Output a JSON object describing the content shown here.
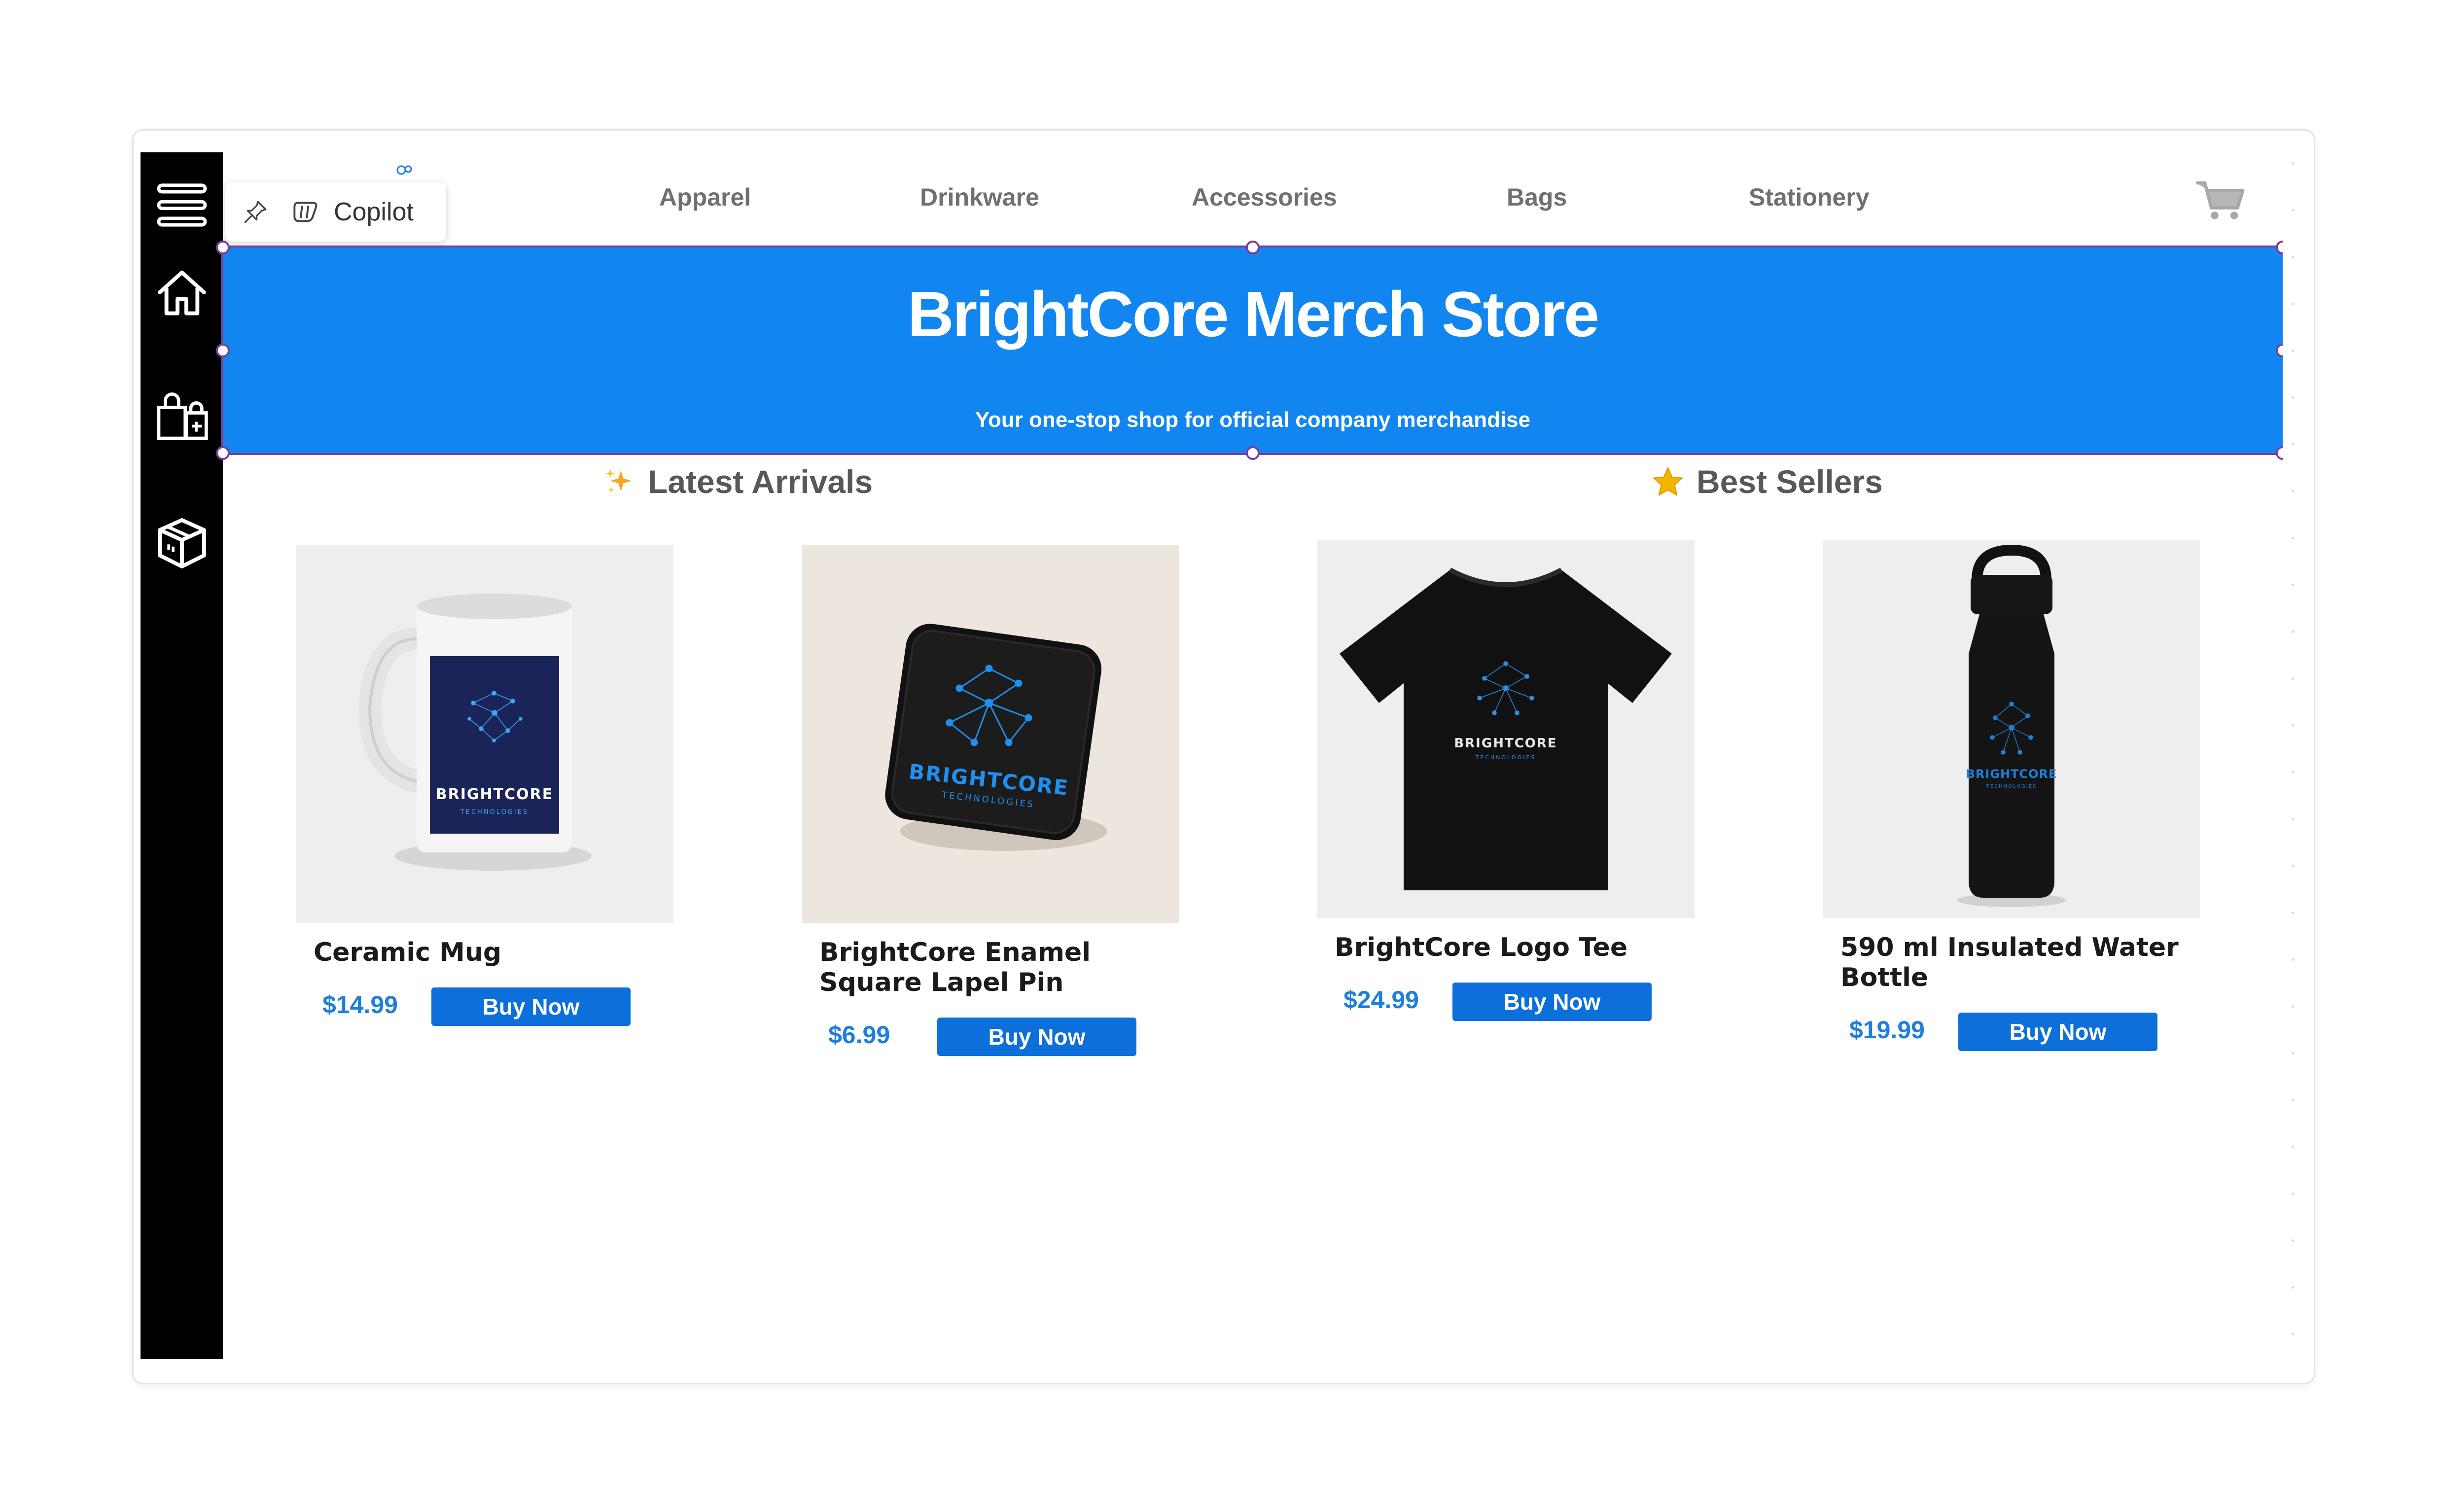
{
  "nav": {
    "items": [
      "Apparel",
      "Drinkware",
      "Accessories",
      "Bags",
      "Stationery"
    ]
  },
  "copilot": {
    "label": "Copilot"
  },
  "banner": {
    "title": "BrightCore Merch Store",
    "subtitle": "Your one-stop shop for official company merchandise"
  },
  "sections": {
    "latest": {
      "title": "Latest Arrivals",
      "emoji": "sparkles"
    },
    "best": {
      "title": "Best Sellers",
      "emoji": "star"
    }
  },
  "products": [
    {
      "name": "Ceramic Mug",
      "price": "$14.99",
      "button": "Buy Now",
      "image": "mug-image",
      "logo_text": "BRIGHTCORE",
      "logo_sub": "TECHNOLOGIES"
    },
    {
      "name": "BrightCore Enamel Square Lapel Pin",
      "price": "$6.99",
      "button": "Buy Now",
      "image": "pin-image",
      "logo_text": "BRIGHTCORE",
      "logo_sub": "TECHNOLOGIES"
    },
    {
      "name": "BrightCore Logo Tee",
      "price": "$24.99",
      "button": "Buy Now",
      "image": "tee-image",
      "logo_text": "BRIGHTCORE",
      "logo_sub": "TECHNOLOGIES"
    },
    {
      "name": "590 ml Insulated Water Bottle",
      "price": "$19.99",
      "button": "Buy Now",
      "image": "bottle-image",
      "logo_text": "BRIGHTCORE",
      "logo_sub": "TECHNOLOGIES"
    }
  ],
  "sidebar": {
    "icons": [
      "hamburger-menu-icon",
      "home-icon",
      "shopping-bags-icon",
      "package-icon"
    ]
  },
  "colors": {
    "banner": "#1186f1",
    "button": "#0d6fd9",
    "price": "#1e7fdc",
    "sidebar": "#000000",
    "selection": "#7a3f96"
  }
}
